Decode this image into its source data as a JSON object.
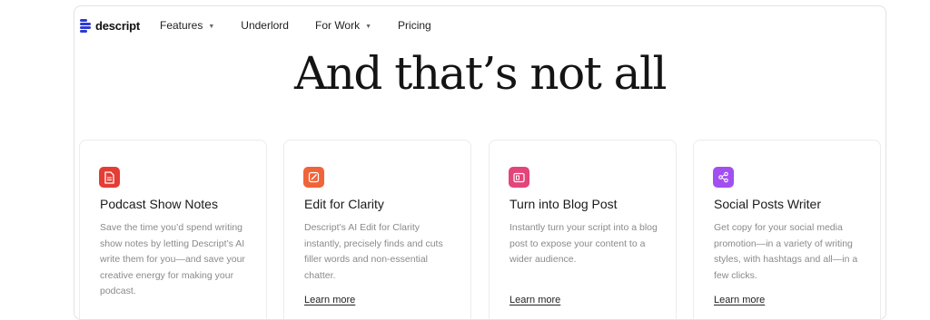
{
  "nav": {
    "logo_text": "descript",
    "items": [
      {
        "label": "Features",
        "has_dropdown": true
      },
      {
        "label": "Underlord",
        "has_dropdown": false
      },
      {
        "label": "For Work",
        "has_dropdown": true
      },
      {
        "label": "Pricing",
        "has_dropdown": false
      }
    ]
  },
  "headline": "And that’s not all",
  "cards": [
    {
      "icon": "document-icon",
      "icon_color": "#e53d34",
      "title": "Podcast Show Notes",
      "description": "Save the time you’d spend writing show notes by letting Descript’s AI write them for you—and save your creative energy for making your podcast.",
      "link": ""
    },
    {
      "icon": "pencil-icon",
      "icon_color": "#f0643a",
      "title": "Edit for Clarity",
      "description": "Descript’s AI Edit for Clarity instantly, precisely finds and cuts filler words and non-essential chatter.",
      "link": "Learn more"
    },
    {
      "icon": "blog-post-icon",
      "icon_color": "#e2457a",
      "title": "Turn into Blog Post",
      "description": "Instantly turn your script into a blog post to expose your content to a wider audience.",
      "link": "Learn more"
    },
    {
      "icon": "share-icon",
      "icon_color": "#a24ff0",
      "title": "Social Posts Writer",
      "description": "Get copy for your social media promotion—in a variety of writing styles, with hashtags and all—in a few clicks.",
      "link": "Learn more"
    }
  ]
}
